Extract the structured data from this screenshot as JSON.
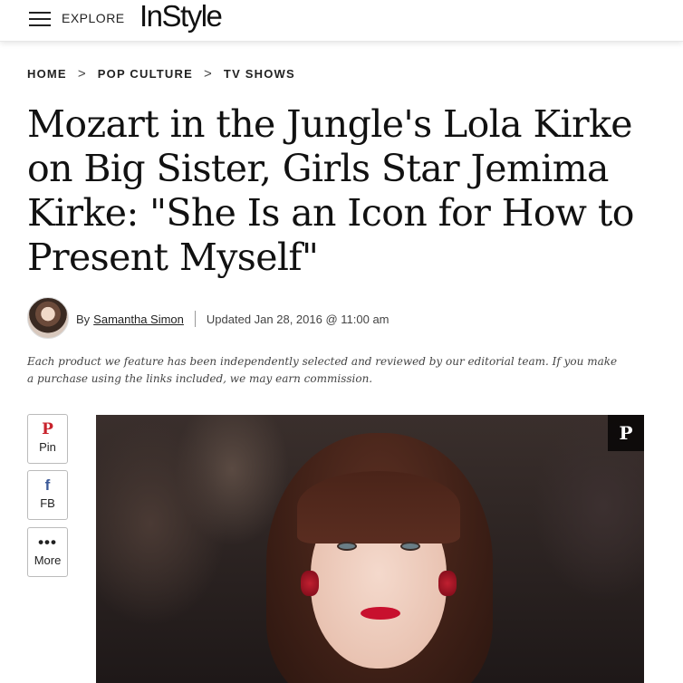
{
  "header": {
    "menu_label": "EXPLORE",
    "logo": "InStyle"
  },
  "breadcrumb": {
    "items": [
      "HOME",
      "POP CULTURE",
      "TV SHOWS"
    ],
    "separator": ">"
  },
  "article": {
    "title": "Mozart in the Jungle's Lola Kirke on Big Sister, Girls Star Jemima Kirke: \"She Is an Icon for How to Present Myself\"",
    "byline_prefix": "By",
    "author": "Samantha Simon",
    "updated": "Updated Jan 28, 2016 @ 11:00 am",
    "disclaimer": "Each product we feature has been independently selected and reviewed by our editorial team. If you make a purchase using the links included, we may earn commission."
  },
  "share": [
    {
      "icon": "pinterest-icon",
      "glyph": "P",
      "label": "Pin"
    },
    {
      "icon": "facebook-icon",
      "glyph": "f",
      "label": "FB"
    },
    {
      "icon": "more-icon",
      "glyph": "•••",
      "label": "More"
    }
  ],
  "hero": {
    "pin_glyph": "P"
  },
  "colors": {
    "pinterest": "#c8232c",
    "facebook": "#3b5998",
    "text": "#111111"
  }
}
